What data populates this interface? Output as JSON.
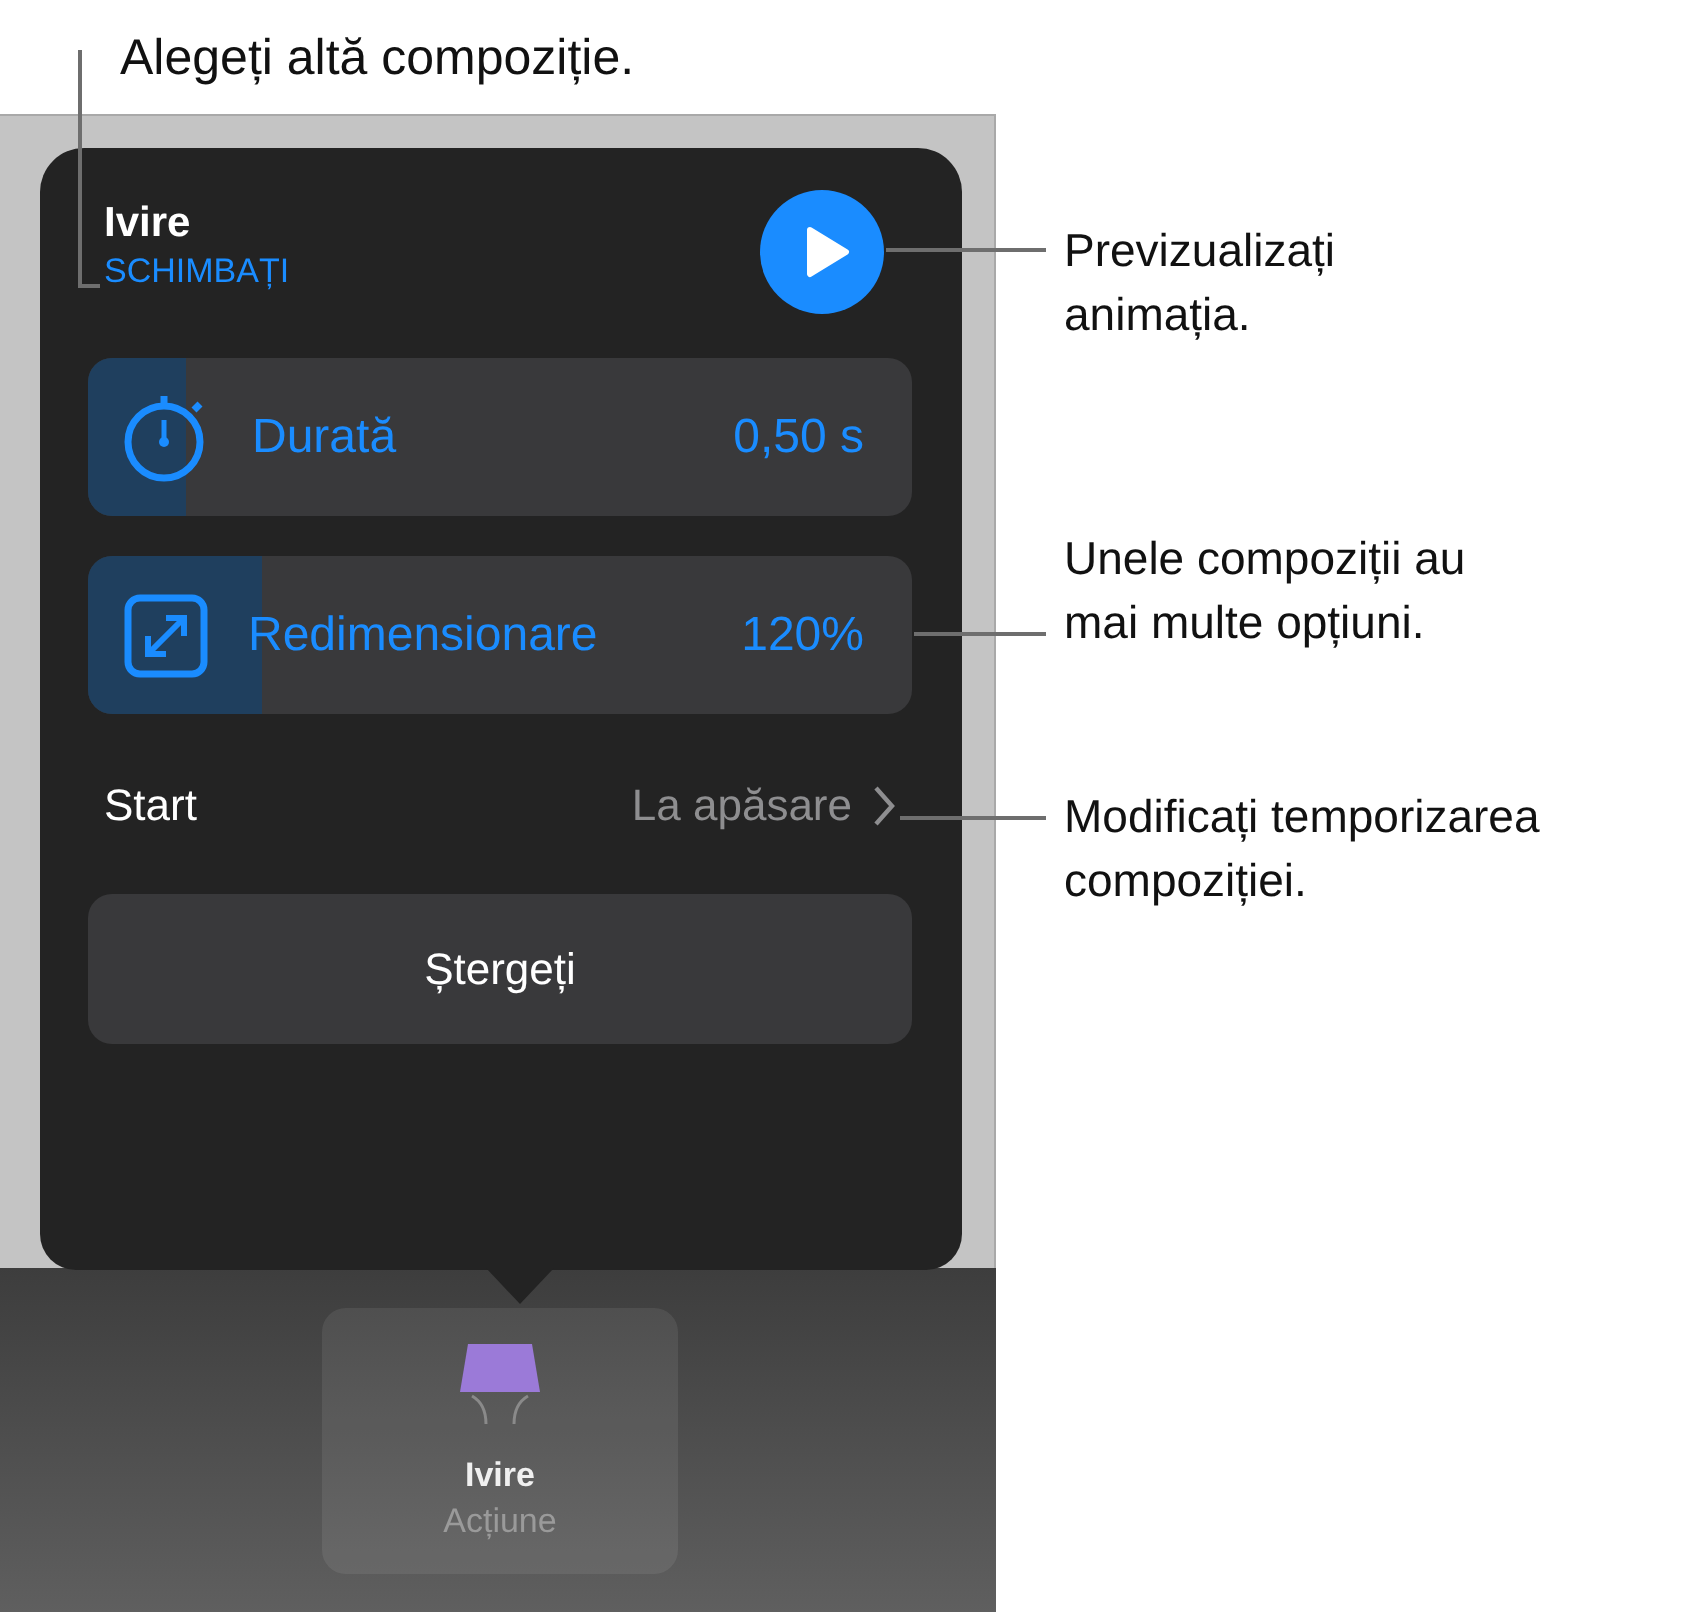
{
  "callouts": [
    {
      "kind": "top",
      "lines": [
        "Alegeți altă compoziție."
      ]
    },
    {
      "kind": "play",
      "lines": [
        "Previzualizați",
        "animația."
      ]
    },
    {
      "kind": "slider",
      "lines": [
        "Unele compoziții au",
        "mai multe opțiuni."
      ]
    },
    {
      "kind": "start",
      "lines": [
        "Modificați temporizarea",
        "compoziției."
      ]
    }
  ],
  "popover": {
    "title": "Ivire",
    "change_link": "SCHIMBAȚI",
    "sliders": [
      {
        "kind": "timer",
        "label": "Durată",
        "value": "0,50 s",
        "level": 0.12
      },
      {
        "kind": "resize",
        "label": "Redimensionare",
        "value": "120%",
        "level": 0.21
      }
    ],
    "start": {
      "label": "Start",
      "value": "La apăsare"
    },
    "delete_button": "Ștergeți"
  },
  "tile": {
    "title": "Ivire",
    "subtitle": "Acțiune"
  }
}
